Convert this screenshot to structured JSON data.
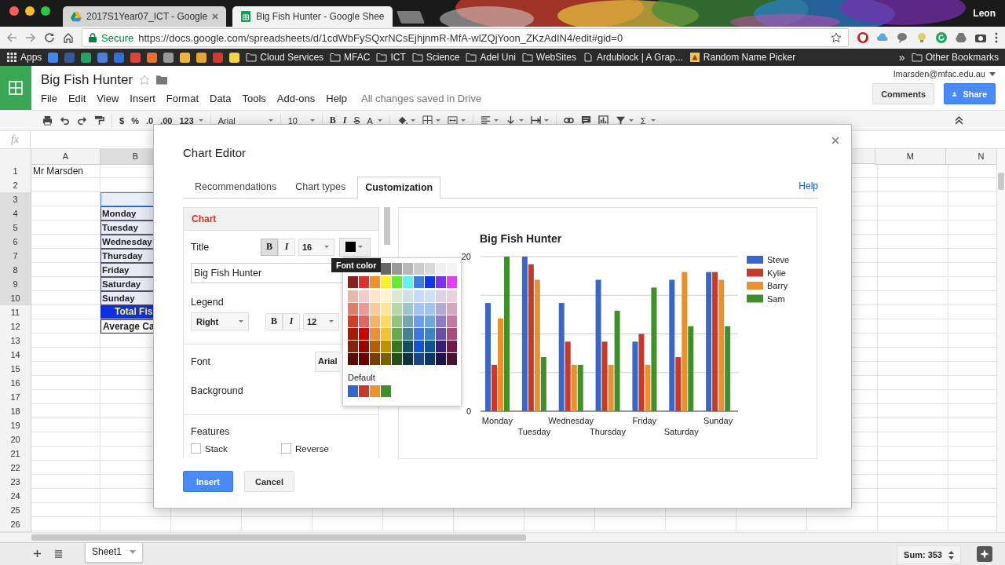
{
  "browser": {
    "tabs": [
      {
        "title": "2017S1Year07_ICT - Google",
        "selected": false
      },
      {
        "title": "Big Fish Hunter - Google Shee",
        "selected": true
      }
    ],
    "user": "Leon",
    "secure_label": "Secure",
    "url": "https://docs.google.com/spreadsheets/d/1cdWbFySQxrNCsEjhjnmR-MfA-wlZQjYoon_ZKzAdIN4/edit#gid=0",
    "bookmarks": [
      {
        "kind": "apps",
        "label": "Apps"
      },
      {
        "kind": "favicon",
        "color": "#4285f4"
      },
      {
        "kind": "favicon",
        "color": "#3b5998"
      },
      {
        "kind": "favicon",
        "color": "#1fa463"
      },
      {
        "kind": "favicon",
        "color": "#4a7fd6"
      },
      {
        "kind": "favicon",
        "color": "#2f6fd8"
      },
      {
        "kind": "favicon",
        "color": "#d8453a"
      },
      {
        "kind": "favicon",
        "color": "#e5712a"
      },
      {
        "kind": "favicon",
        "color": "#9a9a9a"
      },
      {
        "kind": "favicon",
        "color": "#f2b632"
      },
      {
        "kind": "favicon",
        "color": "#e5a72b"
      },
      {
        "kind": "favicon",
        "color": "#d23b2b"
      },
      {
        "kind": "favicon",
        "color": "#f5d547"
      },
      {
        "kind": "folder",
        "label": "Cloud Services"
      },
      {
        "kind": "folder",
        "label": "MFAC"
      },
      {
        "kind": "folder",
        "label": "ICT"
      },
      {
        "kind": "folder",
        "label": "Science"
      },
      {
        "kind": "folder",
        "label": "Adel Uni"
      },
      {
        "kind": "folder",
        "label": "WebSites"
      },
      {
        "kind": "page",
        "label": "Ardublock | A Grap..."
      },
      {
        "kind": "site",
        "label": "Random Name Picker"
      }
    ],
    "more_bookmarks": "»",
    "other_bookmarks": "Other Bookmarks"
  },
  "document": {
    "title": "Big Fish Hunter",
    "menu": [
      "File",
      "Edit",
      "View",
      "Insert",
      "Format",
      "Data",
      "Tools",
      "Add-ons",
      "Help"
    ],
    "save_status": "All changes saved in Drive",
    "account": "lmarsden@mfac.edu.au",
    "comments_button": "Comments",
    "share_button": "Share"
  },
  "toolbar": {
    "currency": "$",
    "percent": "%",
    "decrease_decimals": ".0",
    "increase_decimals": ".00",
    "more_formats": "123",
    "font": "Arial",
    "font_size": "10",
    "bold": "B",
    "italic": "I",
    "strikethrough": "S",
    "text_color": "A",
    "functions": "Σ"
  },
  "formula_bar": {
    "label": "fx"
  },
  "sheet": {
    "columns": [
      {
        "label": "A",
        "selected": false
      },
      {
        "label": "B",
        "selected": true
      },
      {
        "label": "M",
        "selected": false
      },
      {
        "label": "N",
        "selected": false
      }
    ],
    "rows": [
      {
        "number": "1",
        "selected": false,
        "a": "Mr Marsden"
      },
      {
        "number": "2",
        "selected": false
      },
      {
        "number": "3",
        "selected": true,
        "b": {
          "kind": "active"
        }
      },
      {
        "number": "4",
        "selected": true,
        "b": {
          "kind": "day",
          "text": "Monday"
        }
      },
      {
        "number": "5",
        "selected": true,
        "b": {
          "kind": "day",
          "text": "Tuesday"
        }
      },
      {
        "number": "6",
        "selected": true,
        "b": {
          "kind": "day",
          "text": "Wednesday"
        }
      },
      {
        "number": "7",
        "selected": true,
        "b": {
          "kind": "day",
          "text": "Thursday"
        }
      },
      {
        "number": "8",
        "selected": true,
        "b": {
          "kind": "day",
          "text": "Friday"
        }
      },
      {
        "number": "9",
        "selected": true,
        "b": {
          "kind": "day",
          "text": "Saturday"
        }
      },
      {
        "number": "10",
        "selected": true,
        "b": {
          "kind": "day",
          "text": "Sunday"
        }
      },
      {
        "number": "11",
        "selected": false,
        "b": {
          "kind": "total",
          "text": "Total Fis"
        }
      },
      {
        "number": "12",
        "selected": false,
        "b": {
          "kind": "average",
          "text": "Average Ca"
        }
      },
      {
        "number": "13",
        "selected": false
      },
      {
        "number": "14",
        "selected": false
      },
      {
        "number": "15",
        "selected": false
      },
      {
        "number": "16",
        "selected": false
      },
      {
        "number": "17",
        "selected": false
      },
      {
        "number": "18",
        "selected": false
      },
      {
        "number": "19",
        "selected": false
      },
      {
        "number": "20",
        "selected": false
      },
      {
        "number": "21",
        "selected": false
      },
      {
        "number": "22",
        "selected": false
      },
      {
        "number": "23",
        "selected": false
      },
      {
        "number": "24",
        "selected": false
      },
      {
        "number": "25",
        "selected": false
      },
      {
        "number": "26",
        "selected": false
      }
    ],
    "tabs": [
      {
        "label": "Sheet1",
        "selected": true
      }
    ],
    "sum": "Sum: 353"
  },
  "dialog": {
    "title": "Chart Editor",
    "tabs": [
      {
        "label": "Recommendations",
        "selected": false
      },
      {
        "label": "Chart types",
        "selected": false
      },
      {
        "label": "Customization",
        "selected": true
      }
    ],
    "help": "Help",
    "panel": {
      "section": "Chart",
      "title_label": "Title",
      "title_style": {
        "bold": {
          "label": "B",
          "on": true
        },
        "italic": {
          "label": "I",
          "on": false
        },
        "size": "16",
        "color": "#000000"
      },
      "title_value": "Big Fish Hunter",
      "legend_label": "Legend",
      "legend_position": "Right",
      "legend_style": {
        "bold": {
          "label": "B",
          "on": false
        },
        "italic": {
          "label": "I",
          "on": false
        },
        "size": "12"
      },
      "font_label": "Font",
      "font_value": "Arial",
      "background_label": "Background",
      "features_label": "Features",
      "checkboxes": [
        {
          "label": "Stack",
          "checked": false
        },
        {
          "label": "Reverse",
          "checked": false
        }
      ]
    },
    "palette": {
      "tooltip": "Font color",
      "rows": [
        {
          "swatches": [
            {
              "color": "#666666"
            },
            {
              "color": "#999999"
            },
            {
              "color": "#b7b7b7"
            },
            {
              "color": "#cccccc"
            },
            {
              "color": "#d9d9d9"
            },
            {
              "color": "#efefef"
            },
            {
              "color": "#f3f3f3"
            }
          ]
        },
        {
          "swatches": [
            {
              "color": "#8a1f1f"
            },
            {
              "color": "#dd3030"
            },
            {
              "color": "#ea922f"
            },
            {
              "color": "#f8f02c"
            },
            {
              "color": "#62ec2c"
            },
            {
              "color": "#62f2ee"
            },
            {
              "color": "#3f7fd9"
            },
            {
              "color": "#1236ea"
            },
            {
              "color": "#7b30ef"
            },
            {
              "color": "#e040ef"
            }
          ]
        },
        {
          "swatches": [
            {
              "color": "#e6b8af"
            },
            {
              "color": "#f4cccc"
            },
            {
              "color": "#fce5cd"
            },
            {
              "color": "#fff2cc"
            },
            {
              "color": "#d9ead3"
            },
            {
              "color": "#d0e0e3"
            },
            {
              "color": "#c9daf8"
            },
            {
              "color": "#cfe2f3"
            },
            {
              "color": "#d9d2e9"
            },
            {
              "color": "#ead1dc"
            }
          ]
        },
        {
          "swatches": [
            {
              "color": "#dd7e6b"
            },
            {
              "color": "#ea9999"
            },
            {
              "color": "#f9cb9c"
            },
            {
              "color": "#ffe599"
            },
            {
              "color": "#b6d7a8"
            },
            {
              "color": "#a2c4c9"
            },
            {
              "color": "#a4c2f4"
            },
            {
              "color": "#9fc5e8"
            },
            {
              "color": "#b4a7d6"
            },
            {
              "color": "#d5a6bd"
            }
          ]
        },
        {
          "swatches": [
            {
              "color": "#cc4125"
            },
            {
              "color": "#e06666"
            },
            {
              "color": "#f6b26b"
            },
            {
              "color": "#ffd966"
            },
            {
              "color": "#93c47d"
            },
            {
              "color": "#76a5af"
            },
            {
              "color": "#6d9eeb"
            },
            {
              "color": "#6fa8dc"
            },
            {
              "color": "#8e7cc3"
            },
            {
              "color": "#c27ba0"
            }
          ]
        },
        {
          "swatches": [
            {
              "color": "#a61c00"
            },
            {
              "color": "#cc0000"
            },
            {
              "color": "#e69138"
            },
            {
              "color": "#f1c232"
            },
            {
              "color": "#6aa84f"
            },
            {
              "color": "#45818e"
            },
            {
              "color": "#3c78d8"
            },
            {
              "color": "#3d85c6"
            },
            {
              "color": "#674ea7"
            },
            {
              "color": "#a64d79"
            }
          ]
        },
        {
          "swatches": [
            {
              "color": "#85200c"
            },
            {
              "color": "#990000"
            },
            {
              "color": "#b45f06"
            },
            {
              "color": "#bf9000"
            },
            {
              "color": "#38761d"
            },
            {
              "color": "#134f5c"
            },
            {
              "color": "#1155cc"
            },
            {
              "color": "#0b5394"
            },
            {
              "color": "#351c75"
            },
            {
              "color": "#741b47"
            }
          ]
        },
        {
          "swatches": [
            {
              "color": "#5b0f00"
            },
            {
              "color": "#660000"
            },
            {
              "color": "#783f04"
            },
            {
              "color": "#7f6000"
            },
            {
              "color": "#274e13"
            },
            {
              "color": "#0c343d"
            },
            {
              "color": "#1c4587"
            },
            {
              "color": "#073763"
            },
            {
              "color": "#20124d"
            },
            {
              "color": "#4c1130"
            }
          ]
        }
      ],
      "default_label": "Default",
      "defaults": [
        {
          "color": "#3366cc"
        },
        {
          "color": "#c9392b"
        },
        {
          "color": "#ea922f"
        },
        {
          "color": "#3d9128"
        }
      ]
    },
    "chart_data": {
      "type": "bar",
      "title": "Big Fish Hunter",
      "categories": [
        "Monday",
        "Tuesday",
        "Wednesday",
        "Thursday",
        "Friday",
        "Saturday",
        "Sunday"
      ],
      "series": [
        {
          "name": "Steve",
          "color": "#3a66c6",
          "values": [
            14,
            20,
            14,
            17,
            9,
            17,
            18
          ]
        },
        {
          "name": "Kylie",
          "color": "#c53a2b",
          "values": [
            6,
            19,
            9,
            9,
            10,
            7,
            18
          ]
        },
        {
          "name": "Barry",
          "color": "#e8912e",
          "values": [
            12,
            17,
            6,
            6,
            6,
            18,
            17
          ]
        },
        {
          "name": "Sam",
          "color": "#3f8f2a",
          "values": [
            20,
            7,
            6,
            13,
            16,
            11,
            11
          ]
        }
      ],
      "ylim": [
        0,
        20
      ],
      "yticks": [
        0,
        20
      ],
      "legend": "right"
    },
    "insert_button": "Insert",
    "cancel_button": "Cancel"
  }
}
